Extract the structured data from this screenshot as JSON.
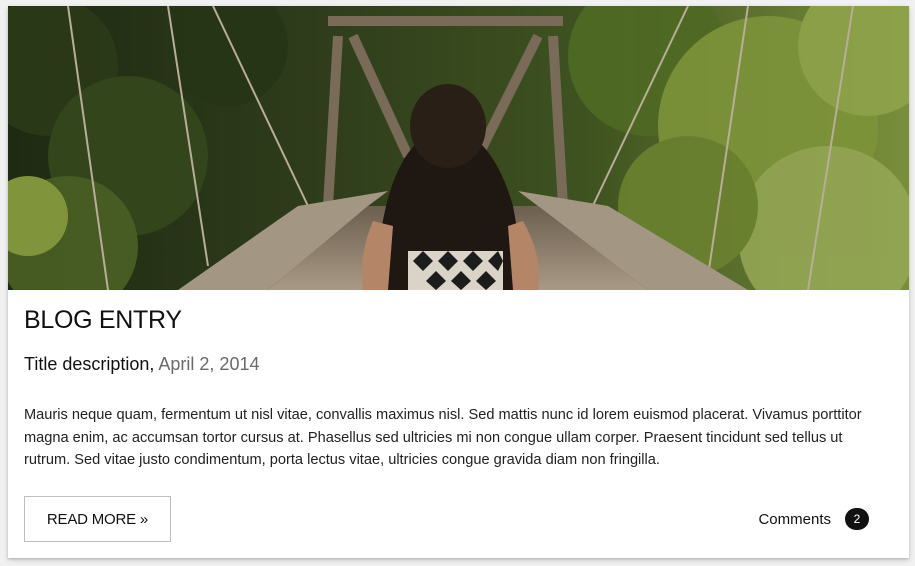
{
  "post": {
    "image_alt": "Woman walking across a wooden suspension bridge in the forest",
    "title": "BLOG ENTRY",
    "subtitle": "Title description,",
    "date": "April 2, 2014",
    "body": "Mauris neque quam, fermentum ut nisl vitae, convallis maximus nisl. Sed mattis nunc id lorem euismod placerat. Vivamus porttitor magna enim, ac accumsan tortor cursus at. Phasellus sed ultricies mi non congue ullam corper. Praesent tincidunt sed tellus ut rutrum. Sed vitae justo condimentum, porta lectus vitae, ultricies congue gravida diam non fringilla.",
    "read_more_label": "READ MORE »",
    "comments_label": "Comments",
    "comments_count": "2"
  },
  "colors": {
    "foliage_dark": "#243318",
    "foliage_light": "#6f8a2e",
    "bridge_wood": "#9a8a74",
    "badge_bg": "#111111"
  }
}
